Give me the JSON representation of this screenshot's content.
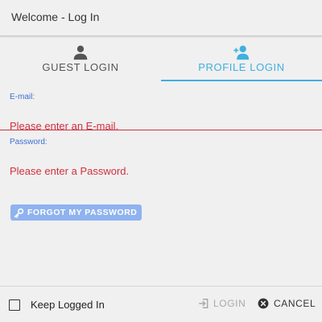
{
  "window": {
    "title": "Welcome - Log In"
  },
  "tabs": [
    {
      "label": "GUEST LOGIN",
      "icon": "person-icon",
      "active": false
    },
    {
      "label": "PROFILE LOGIN",
      "icon": "person-add-icon",
      "active": true
    }
  ],
  "form": {
    "email": {
      "label": "E-mail:",
      "value": "",
      "placeholder": "Please enter an E-mail."
    },
    "password": {
      "label": "Password:",
      "value": "",
      "placeholder": "Please enter a Password."
    },
    "forgot_label": "FORGOT MY PASSWORD"
  },
  "footer": {
    "keep_logged_in": {
      "label": "Keep Logged In",
      "checked": false
    },
    "login_label": "LOGIN",
    "cancel_label": "CANCEL"
  },
  "colors": {
    "accent": "#3fb0e0",
    "error": "#d0303f",
    "field_label": "#3d6fd6",
    "forgot_button": "#8fb3ef",
    "disabled_text": "#a9a9a9"
  }
}
